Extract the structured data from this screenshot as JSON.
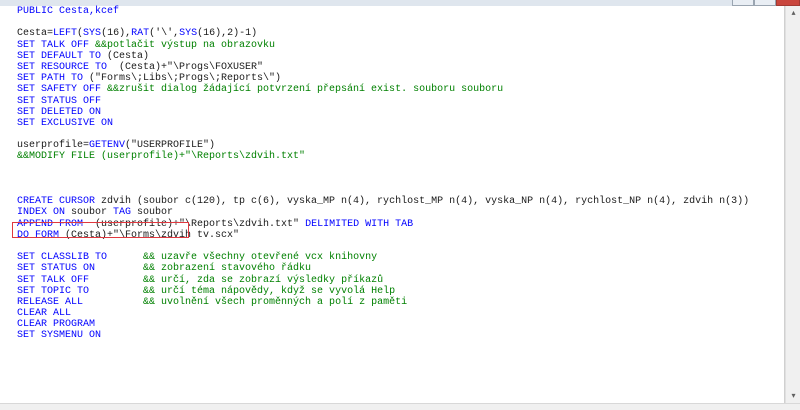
{
  "window": {
    "close_symbol": "×"
  },
  "scrollbar": {
    "up_arrow": "▴",
    "down_arrow": "▾"
  },
  "code_lines": [
    [
      {
        "t": "kw",
        "s": "PUBLIC Cesta,kcef"
      }
    ],
    [],
    [
      {
        "t": "tx",
        "s": "Cesta="
      },
      {
        "t": "kw",
        "s": "LEFT"
      },
      {
        "t": "tx",
        "s": "("
      },
      {
        "t": "kw",
        "s": "SYS"
      },
      {
        "t": "tx",
        "s": "(16),"
      },
      {
        "t": "kw",
        "s": "RAT"
      },
      {
        "t": "tx",
        "s": "('\\',"
      },
      {
        "t": "kw",
        "s": "SYS"
      },
      {
        "t": "tx",
        "s": "(16),2)-1)"
      }
    ],
    [
      {
        "t": "kw",
        "s": "SET TALK OFF "
      },
      {
        "t": "cm",
        "s": "&&potlačit výstup na obrazovku"
      }
    ],
    [
      {
        "t": "kw",
        "s": "SET DEFAULT TO "
      },
      {
        "t": "tx",
        "s": "(Cesta)"
      }
    ],
    [
      {
        "t": "kw",
        "s": "SET RESOURCE TO "
      },
      {
        "t": "tx",
        "s": " (Cesta)+\"\\Progs\\FOXUSER\""
      }
    ],
    [
      {
        "t": "kw",
        "s": "SET PATH TO "
      },
      {
        "t": "tx",
        "s": "(\"Forms\\;Libs\\;Progs\\;Reports\\\")"
      }
    ],
    [
      {
        "t": "kw",
        "s": "SET SAFETY OFF "
      },
      {
        "t": "cm",
        "s": "&&zrušit dialog žádající potvrzení přepsání exist. souboru souboru"
      }
    ],
    [
      {
        "t": "kw",
        "s": "SET STATUS OFF"
      }
    ],
    [
      {
        "t": "kw",
        "s": "SET DELETED ON"
      }
    ],
    [
      {
        "t": "kw",
        "s": "SET EXCLUSIVE ON"
      }
    ],
    [],
    [
      {
        "t": "tx",
        "s": "userprofile="
      },
      {
        "t": "kw",
        "s": "GETENV"
      },
      {
        "t": "tx",
        "s": "(\"USERPROFILE\")"
      }
    ],
    [
      {
        "t": "cm",
        "s": "&&MODIFY FILE (userprofile)+\"\\Reports\\zdvih.txt\""
      }
    ],
    [],
    [],
    [],
    [
      {
        "t": "kw",
        "s": "CREATE CURSOR "
      },
      {
        "t": "tx",
        "s": "zdvih (soubor c(120), tp c(6), vyska_MP n(4), rychlost_MP n(4), vyska_NP n(4), rychlost_NP n(4), zdvih n(3))"
      }
    ],
    [
      {
        "t": "kw",
        "s": "INDEX ON "
      },
      {
        "t": "tx",
        "s": "soubor "
      },
      {
        "t": "kw",
        "s": "TAG "
      },
      {
        "t": "tx",
        "s": "soubor"
      }
    ],
    [
      {
        "t": "kw",
        "s": "APPEND FROM "
      },
      {
        "t": "tx",
        "s": " (userprofile)+\"\\Reports\\zdvih.txt\" "
      },
      {
        "t": "kw",
        "s": "DELIMITED WITH TAB"
      }
    ],
    [
      {
        "t": "kw",
        "s": "DO FORM "
      },
      {
        "t": "tx",
        "s": "(Cesta)+\"\\Forms\\zdvih tv.scx\""
      }
    ],
    [],
    [
      {
        "t": "kw",
        "s": "SET CLASSLIB TO      "
      },
      {
        "t": "cm",
        "s": "&& uzavře všechny otevřené vcx knihovny"
      }
    ],
    [
      {
        "t": "kw",
        "s": "SET STATUS ON        "
      },
      {
        "t": "cm",
        "s": "&& zobrazení stavového řádku"
      }
    ],
    [
      {
        "t": "kw",
        "s": "SET TALK OFF         "
      },
      {
        "t": "cm",
        "s": "&& určí, zda se zobrazí výsledky příkazů"
      }
    ],
    [
      {
        "t": "kw",
        "s": "SET TOPIC TO         "
      },
      {
        "t": "cm",
        "s": "&& určí téma nápovědy, když se vyvolá Help"
      }
    ],
    [
      {
        "t": "kw",
        "s": "RELEASE ALL          "
      },
      {
        "t": "cm",
        "s": "&& uvolnění všech proměnných a polí z paměti"
      }
    ],
    [
      {
        "t": "kw",
        "s": "CLEAR ALL"
      }
    ],
    [
      {
        "t": "kw",
        "s": "CLEAR PROGRAM"
      }
    ],
    [
      {
        "t": "kw",
        "s": "SET SYSMENU ON"
      }
    ]
  ],
  "highlighted_line_index": 18
}
